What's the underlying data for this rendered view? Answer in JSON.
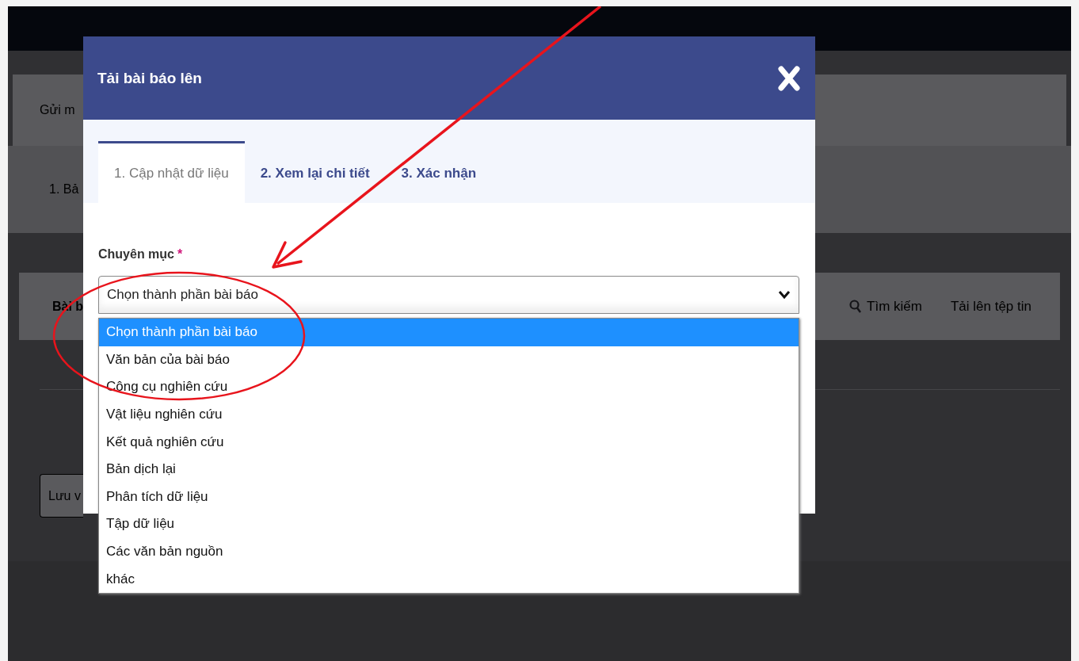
{
  "background_page": {
    "header_text": "Gửi m",
    "step_text": "1. Bả",
    "panel_title": "Bài b",
    "search_link": "Tìm kiếm",
    "upload_link": "Tải lên tệp tin",
    "save_button": "Lưu v"
  },
  "dialog": {
    "title": "Tải bài báo lên",
    "tabs": [
      {
        "label": "1. Cập nhật dữ liệu",
        "selected": true
      },
      {
        "label": "2. Xem lại chi tiết",
        "selected": false
      },
      {
        "label": "3. Xác nhận",
        "selected": false
      }
    ],
    "field": {
      "label": "Chuyên mục",
      "required_mark": "*",
      "value": "Chọn thành phần bài báo",
      "expanded": true,
      "options": [
        {
          "label": "Chọn thành phần bài báo",
          "selected": true
        },
        {
          "label": "Văn bản của bài báo",
          "selected": false
        },
        {
          "label": "Công cụ nghiên cứu",
          "selected": false
        },
        {
          "label": "Vật liệu nghiên cứu",
          "selected": false
        },
        {
          "label": "Kết quả nghiên cứu",
          "selected": false
        },
        {
          "label": "Bản dịch lại",
          "selected": false
        },
        {
          "label": "Phân tích dữ liệu",
          "selected": false
        },
        {
          "label": "Tập dữ liệu",
          "selected": false
        },
        {
          "label": "Các văn bản nguồn",
          "selected": false
        },
        {
          "label": "khác",
          "selected": false
        }
      ]
    }
  }
}
